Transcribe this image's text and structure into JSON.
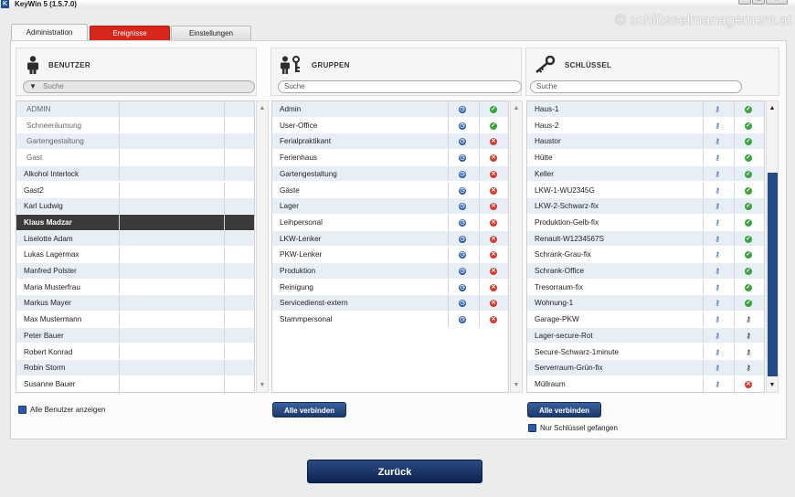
{
  "window": {
    "title": "KeyWin 5 (1.5.7.0)",
    "app_icon": "K",
    "watermark": "© schlüsselmanagement.at"
  },
  "tabs": [
    {
      "label": "Administration",
      "active": true
    },
    {
      "label": "Ereignisse",
      "color": "#d7261b"
    },
    {
      "label": "Einstellungen"
    }
  ],
  "benutzer": {
    "title": "BENUTZER",
    "icon": "user-icon",
    "search_placeholder": "Suche",
    "rows": [
      {
        "name": "ADMIN",
        "indent": true
      },
      {
        "name": "Schneeräumung",
        "indent": true
      },
      {
        "name": "Gartengestaltung",
        "indent": true
      },
      {
        "name": "Gast",
        "indent": true
      },
      {
        "name": "Alkohol Interlock"
      },
      {
        "name": "Gast2"
      },
      {
        "name": "Karl Ludwig"
      },
      {
        "name": "Klaus Madzar",
        "selected": true
      },
      {
        "name": "Liselotte Adam"
      },
      {
        "name": "Lukas Lagermax"
      },
      {
        "name": "Manfred Polster"
      },
      {
        "name": "Maria Musterfrau"
      },
      {
        "name": "Markus Mayer"
      },
      {
        "name": "Max Mustermann"
      },
      {
        "name": "Peter Bauer"
      },
      {
        "name": "Robert Konrad"
      },
      {
        "name": "Robin Storm"
      },
      {
        "name": "Susanne Bauer"
      }
    ],
    "checkbox_label": "Alle Benutzer anzeigen"
  },
  "gruppen": {
    "title": "GRUPPEN",
    "icon": "group-icon",
    "search_placeholder": "Suche",
    "rows": [
      {
        "name": "Admin",
        "status": "ok"
      },
      {
        "name": "User-Office",
        "status": "ok"
      },
      {
        "name": "Ferialpraktikant",
        "status": "no"
      },
      {
        "name": "Ferienhaus",
        "status": "no"
      },
      {
        "name": "Gartengestaltung",
        "status": "no"
      },
      {
        "name": "Gäste",
        "status": "no"
      },
      {
        "name": "Lager",
        "status": "no"
      },
      {
        "name": "Leihpersonal",
        "status": "no"
      },
      {
        "name": "LKW-Lenker",
        "status": "no"
      },
      {
        "name": "PKW-Lenker",
        "status": "no"
      },
      {
        "name": "Produktion",
        "status": "no"
      },
      {
        "name": "Reinigung",
        "status": "no"
      },
      {
        "name": "Servicedienst-extern",
        "status": "no"
      },
      {
        "name": "Stammpersonal",
        "status": "no"
      }
    ],
    "button_label": "Alle verbinden"
  },
  "schluessel": {
    "title": "SCHLÜSSEL",
    "icon": "key-icon",
    "search_placeholder": "Suche",
    "rows": [
      {
        "name": "Haus-1",
        "status": "ok"
      },
      {
        "name": "Haus-2",
        "status": "ok"
      },
      {
        "name": "Haustor",
        "status": "ok"
      },
      {
        "name": "Hütte",
        "status": "ok"
      },
      {
        "name": "Keller",
        "status": "ok"
      },
      {
        "name": "LKW-1-WU2345G",
        "status": "ok"
      },
      {
        "name": "LKW-2-Schwarz-fix",
        "status": "ok"
      },
      {
        "name": "Produktion-Gelb-fix",
        "status": "ok"
      },
      {
        "name": "Renault-W1234567S",
        "status": "ok"
      },
      {
        "name": "Schrank-Grau-fix",
        "status": "ok"
      },
      {
        "name": "Schrank-Office",
        "status": "ok"
      },
      {
        "name": "Tresorraum-fix",
        "status": "ok"
      },
      {
        "name": "Wohnung-1",
        "status": "ok"
      },
      {
        "name": "Garage-PKW",
        "status": "key"
      },
      {
        "name": "Lager-secure-Rot",
        "status": "key"
      },
      {
        "name": "Secure-Schwarz-1minute",
        "status": "key"
      },
      {
        "name": "Serverraum-Grün-fix",
        "status": "key"
      },
      {
        "name": "Müllraum",
        "status": "no"
      }
    ],
    "button_label": "Alle verbinden",
    "checkbox_label": "Nur Schlüssel gefangen"
  },
  "footer": {
    "back_label": "Zurück"
  }
}
